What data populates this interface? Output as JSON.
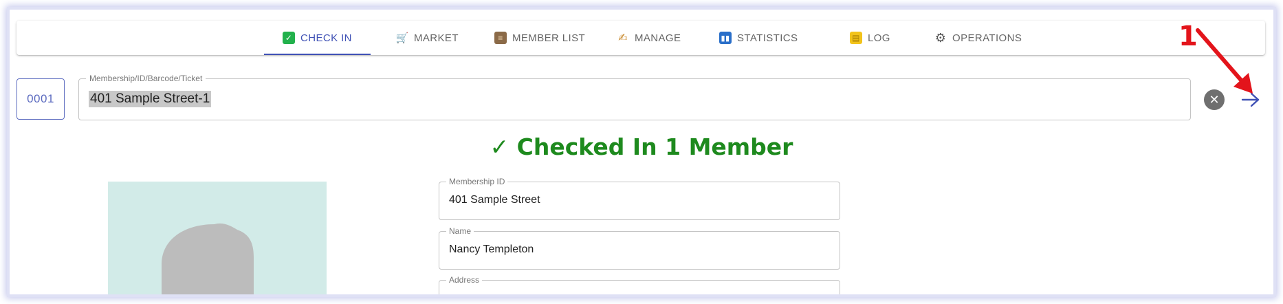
{
  "tabs": [
    {
      "label": "CHECK IN",
      "icon": "check-box-icon",
      "active": true
    },
    {
      "label": "MARKET",
      "icon": "shopping-cart-icon",
      "active": false
    },
    {
      "label": "MEMBER LIST",
      "icon": "scroll-icon",
      "active": false
    },
    {
      "label": "MANAGE",
      "icon": "writing-hand-icon",
      "active": false
    },
    {
      "label": "STATISTICS",
      "icon": "bar-chart-icon",
      "active": false
    },
    {
      "label": "LOG",
      "icon": "ledger-icon",
      "active": false
    },
    {
      "label": "OPERATIONS",
      "icon": "gear-icon",
      "active": false
    }
  ],
  "search": {
    "counter": "0001",
    "label": "Membership/ID/Barcode/Ticket",
    "value": "401 Sample Street-1"
  },
  "status": {
    "message": "✓ Checked In 1 Member",
    "color": "#1e8a1e"
  },
  "member": {
    "fields": [
      {
        "label": "Membership ID",
        "value": "401 Sample Street"
      },
      {
        "label": "Name",
        "value": "Nancy Templeton"
      },
      {
        "label": "Address",
        "value": ""
      }
    ]
  },
  "annotation": {
    "number": "1",
    "color": "#e3141b"
  },
  "colors": {
    "accent": "#3f51b5",
    "success": "#1e8a1e"
  }
}
